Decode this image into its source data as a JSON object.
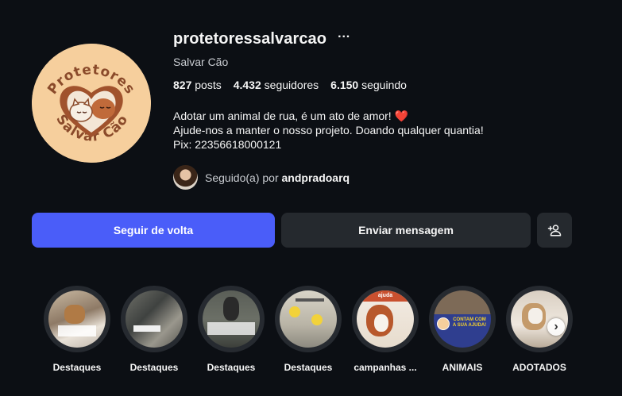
{
  "profile": {
    "username": "protetoressalvarcao",
    "full_name": "Salvar Cão",
    "more_icon": "···",
    "avatar_text_top": "Protetores",
    "avatar_text_bottom": "Salvar Cão"
  },
  "stats": {
    "posts_count": "827",
    "posts_label": "posts",
    "followers_count": "4.432",
    "followers_label": "seguidores",
    "following_count": "6.150",
    "following_label": "seguindo"
  },
  "bio": {
    "line1": "Adotar um animal de rua, é um ato de amor!",
    "line1_emoji": "❤️",
    "line2": "Ajude-nos a manter o nosso projeto. Doando qualquer quantia!",
    "line3": "Pix: 22356618000121"
  },
  "followed_by": {
    "prefix": "Seguido(a) por",
    "user": "andpradoarq"
  },
  "buttons": {
    "follow_back": "Seguir de volta",
    "send_message": "Enviar mensagem",
    "suggest_icon": "person-add-icon"
  },
  "highlights": [
    {
      "label": "Destaques"
    },
    {
      "label": "Destaques"
    },
    {
      "label": "Destaques"
    },
    {
      "label": "Destaques"
    },
    {
      "label": "campanhas ..."
    },
    {
      "label": "ANIMAIS"
    },
    {
      "label": "ADOTADOS"
    }
  ],
  "highlight_thumb_texts": {
    "h5_top": "ajuda",
    "h6_banner": "CONTAM COM A SUA AJUDA!"
  },
  "colors": {
    "background": "#0c0f14",
    "primary_button": "#4a5df9",
    "secondary_button": "#25292e",
    "avatar_bg": "#f6cf9d",
    "heart": "#ed4956"
  }
}
